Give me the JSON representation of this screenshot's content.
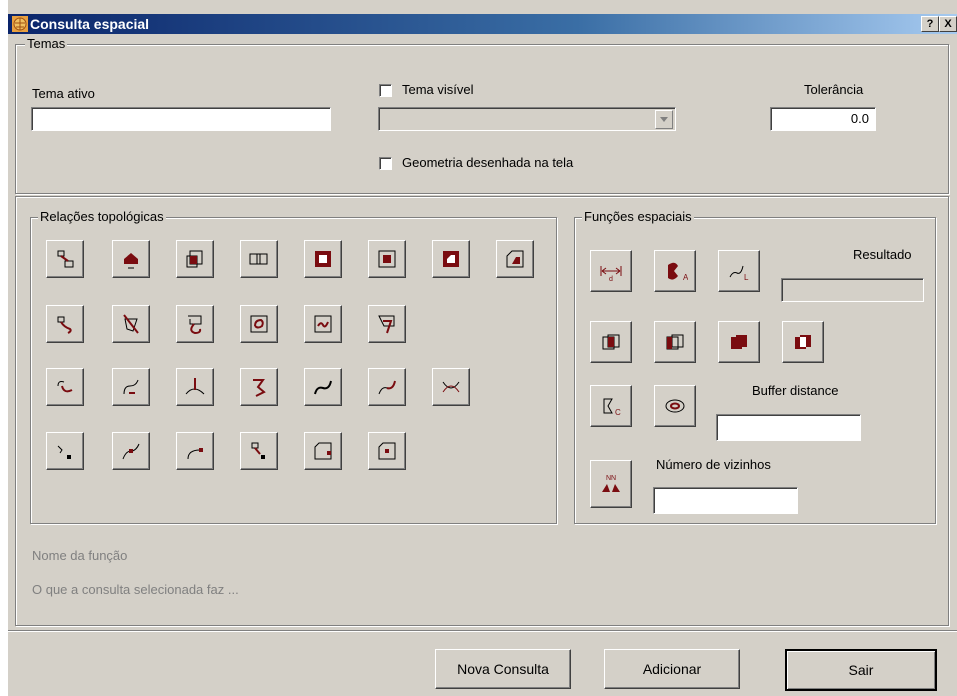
{
  "window": {
    "title": "Consulta espacial",
    "help_btn": "?",
    "close_btn": "X"
  },
  "temas": {
    "legend": "Temas",
    "tema_ativo_label": "Tema ativo",
    "tema_ativo_value": "",
    "tema_visivel_label": "Tema visível",
    "geometria_label": "Geometria desenhada na tela",
    "tolerancia_label": "Tolerância",
    "tolerancia_value": "0.0"
  },
  "relacoes": {
    "legend": "Relações topológicas"
  },
  "funcoes": {
    "legend": "Funções espaciais",
    "resultado_label": "Resultado",
    "resultado_value": "",
    "buffer_label": "Buffer distance",
    "buffer_value": "",
    "vizinhos_label": "Número de vizinhos",
    "vizinhos_value": ""
  },
  "info": {
    "nome_funcao": "Nome da função",
    "descricao": "O que a consulta selecionada faz ..."
  },
  "buttons": {
    "nova": "Nova Consulta",
    "adicionar": "Adicionar",
    "sair": "Sair"
  },
  "colors": {
    "accent": "#7a0c10",
    "face": "#d4d0c8"
  }
}
